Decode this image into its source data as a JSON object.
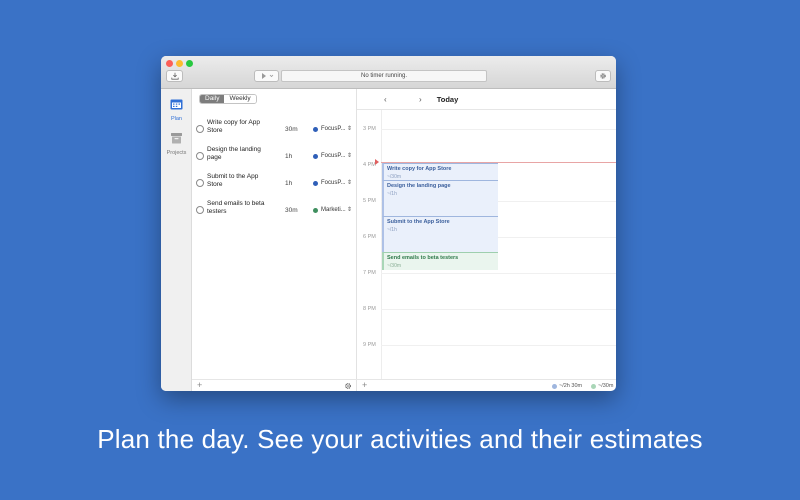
{
  "window": {
    "timer_text": "No timer running."
  },
  "colors": {
    "background": "#3a72c6",
    "accent": "#2f6fd6",
    "focus_project": "#2f5fb8",
    "marketing_project": "#3f8f5f",
    "close": "#fc5f57",
    "minimize": "#fdbc2e",
    "zoom": "#28c840"
  },
  "sidebar": {
    "items": [
      {
        "label": "Plan",
        "icon": "calendar-icon",
        "active": true
      },
      {
        "label": "Projects",
        "icon": "archive-box-icon",
        "active": false
      }
    ]
  },
  "view_toggle": {
    "options": [
      "Daily",
      "Weekly"
    ],
    "selected": "Daily"
  },
  "tasks": [
    {
      "title": "Write copy for App Store",
      "estimate": "30m",
      "project": "FocusP...",
      "color": "#2f5fb8"
    },
    {
      "title": "Design the landing page",
      "estimate": "1h",
      "project": "FocusP...",
      "color": "#2f5fb8"
    },
    {
      "title": "Submit to the App Store",
      "estimate": "1h",
      "project": "FocusP...",
      "color": "#2f5fb8"
    },
    {
      "title": "Send emails to beta testers",
      "estimate": "30m",
      "project": "Marketi...",
      "color": "#3f8f5f"
    }
  ],
  "calendar": {
    "title": "Today",
    "hours": [
      "3 PM",
      "4 PM",
      "5 PM",
      "6 PM",
      "7 PM",
      "8 PM",
      "9 PM"
    ],
    "events": [
      {
        "title": "Write copy for App Store",
        "estimate": "~/30m",
        "type": "blue"
      },
      {
        "title": "Design the landing page",
        "estimate": "~/1h",
        "type": "blue"
      },
      {
        "title": "Submit to the App Store",
        "estimate": "~/1h",
        "type": "blue"
      },
      {
        "title": "Send emails to beta testers",
        "estimate": "~/30m",
        "type": "green"
      }
    ],
    "summary": [
      {
        "value": "~/2h 30m",
        "color": "#9fb6de"
      },
      {
        "value": "~/30m",
        "color": "#a9d6b7"
      }
    ]
  },
  "caption": "Plan the day. See your activities and their estimates"
}
